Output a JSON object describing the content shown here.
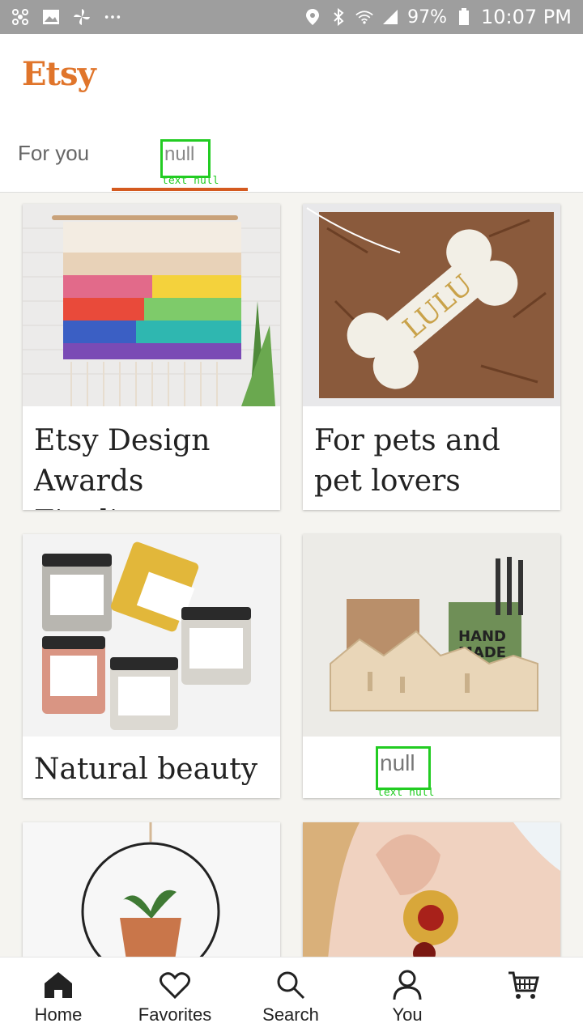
{
  "status_bar": {
    "battery": "97%",
    "time": "10:07 PM",
    "left_icons": [
      "pinwheel-icon",
      "image-icon",
      "fan-icon",
      "more-dots-icon"
    ],
    "right_icons": [
      "location-icon",
      "bluetooth-icon",
      "wifi-icon",
      "signal-icon",
      "battery-icon"
    ]
  },
  "header": {
    "logo": "Etsy",
    "tabs": [
      {
        "label": "For you"
      },
      {
        "label": "null",
        "tag": "text null"
      }
    ],
    "accent_color": "#e0752b"
  },
  "cards": [
    {
      "title": "Etsy Design Awards Finalists",
      "image": "weaving-wall-hanging"
    },
    {
      "title": "For pets and pet lovers",
      "image": "bone-ornament-lulu"
    },
    {
      "title": "Natural beauty",
      "image": "jars-of-scrub"
    },
    {
      "title": "null",
      "tag": "text null",
      "image": "handmade-desk-organizer"
    },
    {
      "title": "",
      "image": "hanging-plant-hoop"
    },
    {
      "title": "",
      "image": "gold-earring"
    }
  ],
  "bottom_nav": [
    {
      "label": "Home",
      "icon": "home-icon"
    },
    {
      "label": "Favorites",
      "icon": "heart-icon"
    },
    {
      "label": "Search",
      "icon": "search-icon"
    },
    {
      "label": "You",
      "icon": "person-icon"
    },
    {
      "label": "",
      "icon": "cart-icon"
    }
  ]
}
